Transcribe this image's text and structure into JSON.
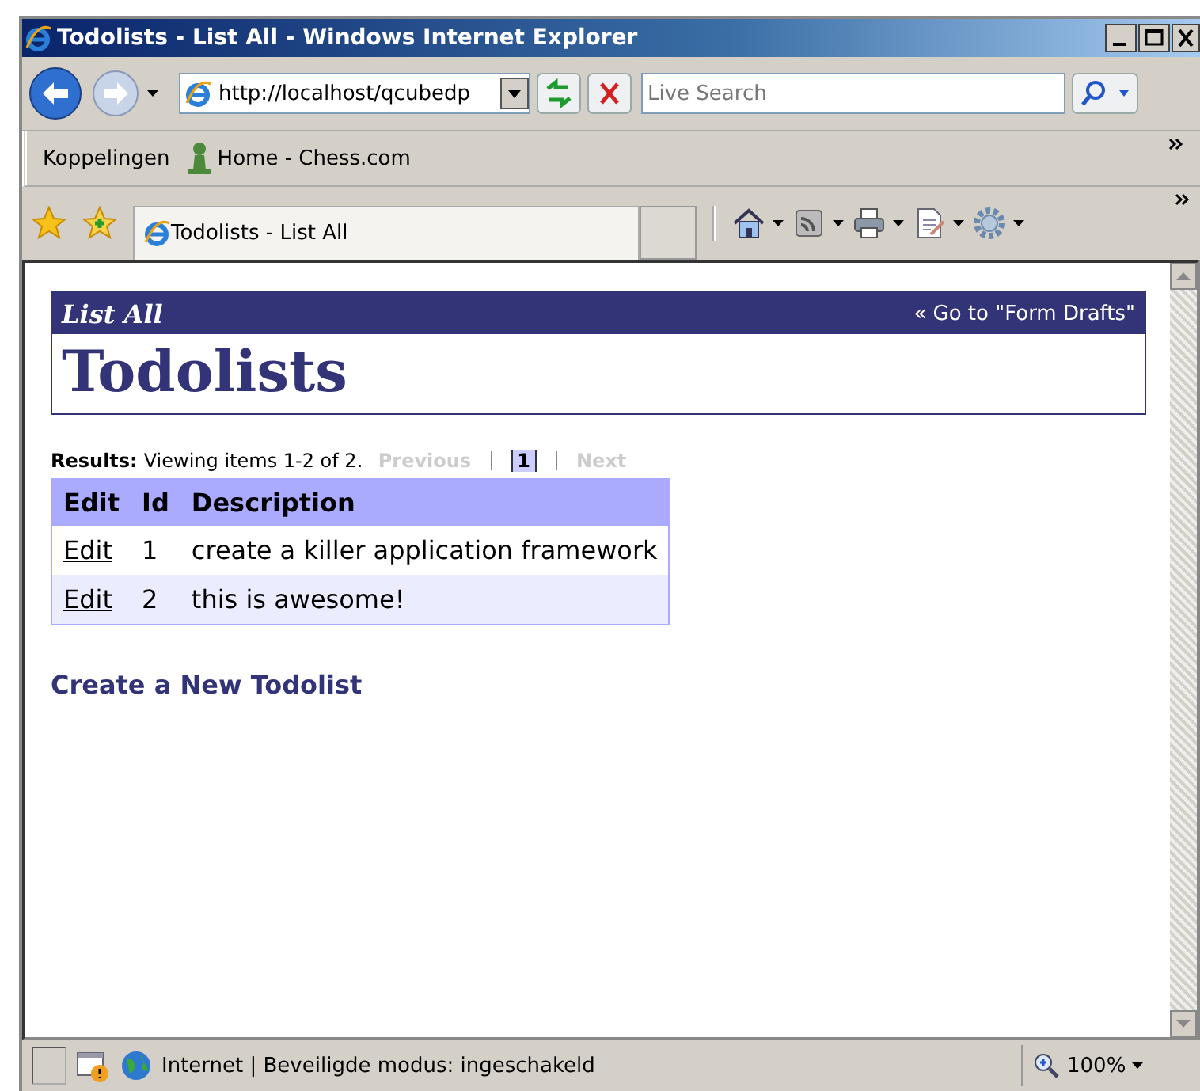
{
  "window": {
    "title": "Todolists - List All - Windows Internet Explorer"
  },
  "address_bar": {
    "value": "http://localhost/qcubedp"
  },
  "search": {
    "placeholder": "Live Search"
  },
  "links_bar": {
    "label": "Koppelingen",
    "links": [
      "Home - Chess.com"
    ]
  },
  "tab": {
    "title": "Todolists - List All"
  },
  "page": {
    "subtitle": "List All",
    "back_link": "« Go to \"Form Drafts\"",
    "heading": "Todolists",
    "results_label": "Results:",
    "results_text": "Viewing items 1-2 of 2.",
    "pagination": {
      "previous": {
        "label": "Previous",
        "disabled": true
      },
      "pages": [
        {
          "label": "1",
          "selected": true
        }
      ],
      "next": {
        "label": "Next",
        "disabled": true
      }
    },
    "table": {
      "columns": [
        "Edit",
        "Id",
        "Description"
      ],
      "rows": [
        {
          "cells": [
            "Edit",
            "1",
            "create a killer application framework"
          ]
        },
        {
          "cells": [
            "Edit",
            "2",
            "this is awesome!"
          ]
        }
      ]
    },
    "create_link": "Create a New Todolist"
  },
  "status_bar": {
    "zone": "Internet | Beveiligde modus: ingeschakeld",
    "zoom": "100%"
  }
}
